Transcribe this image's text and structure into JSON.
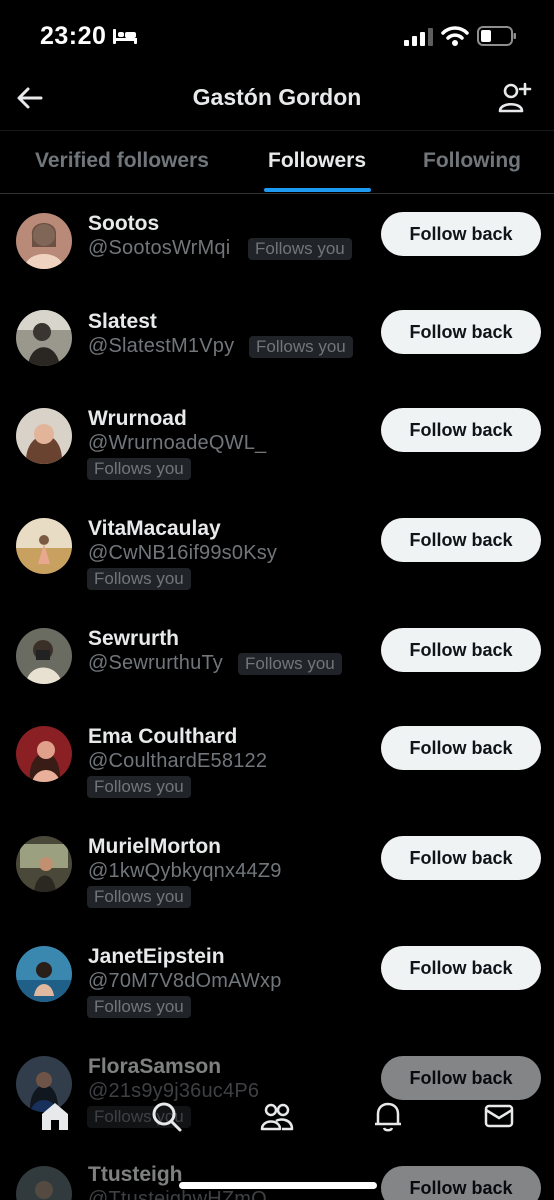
{
  "status_bar": {
    "time": "23:20"
  },
  "header": {
    "title": "Gastón Gordon"
  },
  "tabs": [
    {
      "label": "Verified followers"
    },
    {
      "label": "Followers"
    },
    {
      "label": "Following"
    }
  ],
  "users": [
    {
      "name": "Sootos",
      "handle": "@SootosWrMqi",
      "badge": "Follows you",
      "button": "Follow back",
      "avatar_color": "#c79a86"
    },
    {
      "name": "Slatest",
      "handle": "@SlatestM1Vpy",
      "badge": "Follows you",
      "button": "Follow back",
      "avatar_color": "#7f7f77"
    },
    {
      "name": "Wrurnoad",
      "handle": "@WrurnoadeQWL_",
      "badge": "Follows you",
      "button": "Follow back",
      "avatar_color": "#8b6b5a"
    },
    {
      "name": "VitaMacaulay",
      "handle": "@CwNB16if99s0Ksy",
      "badge": "Follows you",
      "button": "Follow back",
      "avatar_color": "#d6b98a"
    },
    {
      "name": "Sewrurth",
      "handle": "@SewrurthuTy",
      "badge": "Follows you",
      "button": "Follow back",
      "avatar_color": "#6d6f66"
    },
    {
      "name": "Ema Coulthard",
      "handle": "@CoulthardE58122",
      "badge": "Follows you",
      "button": "Follow back",
      "avatar_color": "#a53a3a"
    },
    {
      "name": "MurielMorton",
      "handle": "@1kwQybkyqnx44Z9",
      "badge": "Follows you",
      "button": "Follow back",
      "avatar_color": "#5c5a4a"
    },
    {
      "name": "JanetEipstein",
      "handle": "@70M7V8dOmAWxp",
      "badge": "Follows you",
      "button": "Follow back",
      "avatar_color": "#4a8fb0"
    },
    {
      "name": "FloraSamson",
      "handle": "@21s9y9j36uc4P6",
      "badge": "Follows you",
      "button": "Follow back",
      "avatar_color": "#3d5a7a"
    },
    {
      "name": "Ttusteigh",
      "handle": "@TtusteighwHZmQ",
      "badge": "",
      "button": "Follow back",
      "avatar_color": "#5a6a70"
    }
  ],
  "colors": {
    "accent": "#1d9bf0",
    "background": "#000000",
    "button_bg": "#eff3f4"
  },
  "nav_icons": [
    "home-icon",
    "search-icon",
    "communities-icon",
    "notifications-icon",
    "messages-icon"
  ]
}
